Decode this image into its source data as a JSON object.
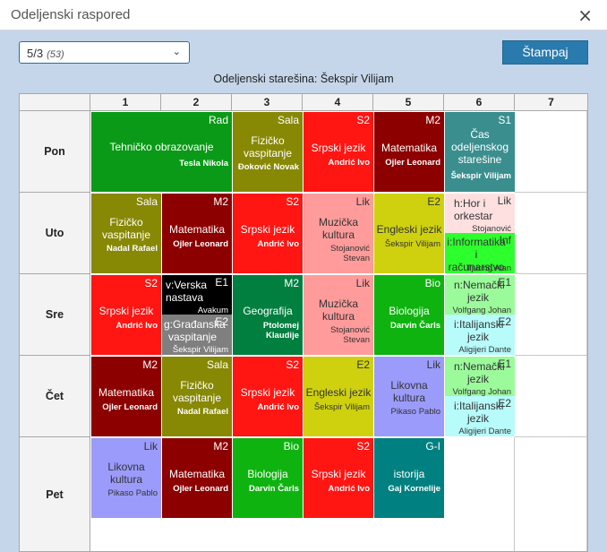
{
  "dialog": {
    "title": "Odeljenski raspored",
    "close_icon": "×"
  },
  "class_select": {
    "value": "5/3",
    "count": "(53)"
  },
  "print_button": "Štampaj",
  "head_teacher": "Odeljenski starešina: Šekspir Vilijam",
  "periods": [
    "1",
    "2",
    "3",
    "4",
    "5",
    "6",
    "7"
  ],
  "days": [
    "Pon",
    "Uto",
    "Sre",
    "Čet",
    "Pet"
  ],
  "colors": {
    "tehnicko": "#0a9a17",
    "fizicko": "#878804",
    "srpski": "#ff1512",
    "matematika": "#8c0000",
    "cas_odeljenskog": "#3a8e8e",
    "muzicka": "#ff9b9b",
    "engleski": "#cfd10e",
    "biologija": "#0fb30f",
    "geografija": "#007f3f",
    "likovna": "#9b9bfb",
    "istorija": "#008080",
    "hor": "#ffe0e0",
    "informatika": "#2dff2d",
    "verska": "#000000",
    "gradjanska": "#7f7f7f",
    "nemacki": "#9bfb9b",
    "italijanski": "#b7fbfb"
  },
  "lessons": {
    "pon_1_2": {
      "room": "Rad",
      "subject": "Tehničko obrazovanje",
      "teacher": "Tesla Nikola"
    },
    "pon_3": {
      "room": "Sala",
      "subject": "Fizičko vaspitanje",
      "teacher": "Đoković Novak"
    },
    "pon_4": {
      "room": "S2",
      "subject": "Srpski jezik",
      "teacher": "Andrić Ivo"
    },
    "pon_5": {
      "room": "M2",
      "subject": "Matematika",
      "teacher": "Ojler Leonard"
    },
    "pon_6": {
      "room": "S1",
      "subject": "Čas odeljenskog starešine",
      "teacher": "Šekspir Vilijam"
    },
    "uto_1": {
      "room": "Sala",
      "subject": "Fizičko vaspitanje",
      "teacher": "Nadal Rafael"
    },
    "uto_2": {
      "room": "M2",
      "subject": "Matematika",
      "teacher": "Ojler Leonard"
    },
    "uto_3": {
      "room": "S2",
      "subject": "Srpski jezik",
      "teacher": "Andrić Ivo"
    },
    "uto_4": {
      "room": "Lik",
      "subject": "Muzička kultura",
      "teacher": "Stojanović Stevan"
    },
    "uto_5": {
      "room": "E2",
      "subject": "Engleski jezik",
      "teacher": "Šekspir Vilijam"
    },
    "uto_6a": {
      "room": "Lik",
      "subject": "h:Hor i orkestar",
      "teacher": "Stojanović"
    },
    "uto_6b": {
      "room": "Inf",
      "subject": "i:Informatika i računarstvo",
      "teacher": "Tjuring Alan"
    },
    "sre_1": {
      "room": "S2",
      "subject": "Srpski jezik",
      "teacher": "Andrić Ivo"
    },
    "sre_2a": {
      "room": "E1",
      "subject": "v:Verska nastava",
      "teacher": "Avakum"
    },
    "sre_2b": {
      "room": "E2",
      "subject": "g:Građanska vaspitanje",
      "teacher": "Šekspir Vilijam"
    },
    "sre_3": {
      "room": "M2",
      "subject": "Geografija",
      "teacher": "Ptolomej Klaudije"
    },
    "sre_4": {
      "room": "Lik",
      "subject": "Muzička kultura",
      "teacher": "Stojanović Stevan"
    },
    "sre_5": {
      "room": "Bio",
      "subject": "Biologija",
      "teacher": "Darvin Čarls"
    },
    "sre_6a": {
      "room": "E1",
      "subject": "n:Nemački jezik",
      "teacher": "Volfgang Johan"
    },
    "sre_6b": {
      "room": "E2",
      "subject": "i:Italijanski jezik",
      "teacher": "Aligijeri Dante"
    },
    "cet_1": {
      "room": "M2",
      "subject": "Matematika",
      "teacher": "Ojler Leonard"
    },
    "cet_2": {
      "room": "Sala",
      "subject": "Fizičko vaspitanje",
      "teacher": "Nadal Rafael"
    },
    "cet_3": {
      "room": "S2",
      "subject": "Srpski jezik",
      "teacher": "Andrić Ivo"
    },
    "cet_4": {
      "room": "E2",
      "subject": "Engleski jezik",
      "teacher": "Šekspir Vilijam"
    },
    "cet_5": {
      "room": "Lik",
      "subject": "Likovna kultura",
      "teacher": "Pikaso Pablo"
    },
    "cet_6a": {
      "room": "E1",
      "subject": "n:Nemački jezik",
      "teacher": "Volfgang Johan"
    },
    "cet_6b": {
      "room": "E2",
      "subject": "i:Italijanski jezik",
      "teacher": "Aligijeri Dante"
    },
    "pet_1": {
      "room": "Lik",
      "subject": "Likovna kultura",
      "teacher": "Pikaso Pablo"
    },
    "pet_2": {
      "room": "M2",
      "subject": "Matematika",
      "teacher": "Ojler Leonard"
    },
    "pet_3": {
      "room": "Bio",
      "subject": "Biologija",
      "teacher": "Darvin Čarls"
    },
    "pet_4": {
      "room": "S2",
      "subject": "Srpski jezik",
      "teacher": "Andrić Ivo"
    },
    "pet_5": {
      "room": "G-I",
      "subject": "istorija",
      "teacher": "Gaj Kornelije"
    }
  }
}
